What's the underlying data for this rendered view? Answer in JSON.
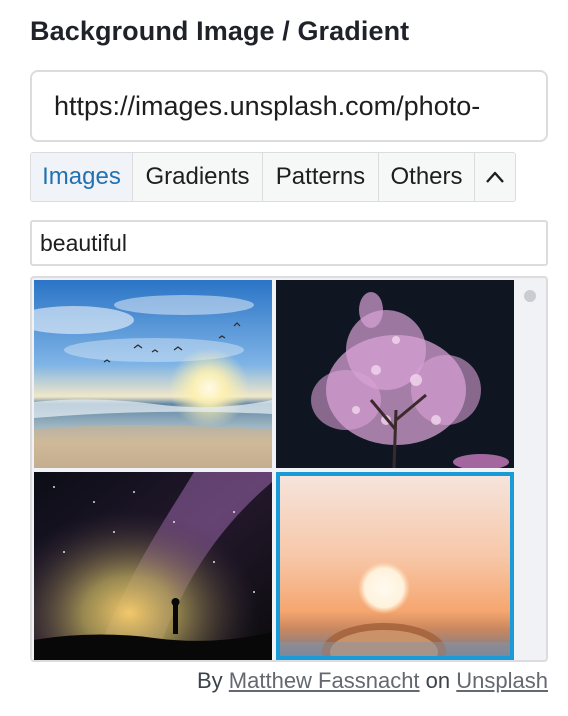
{
  "title": "Background Image / Gradient",
  "url_input": {
    "value": "https://images.unsplash.com/photo-"
  },
  "tabs": [
    {
      "label": "Images",
      "active": true
    },
    {
      "label": "Gradients",
      "active": false
    },
    {
      "label": "Patterns",
      "active": false
    },
    {
      "label": "Others",
      "active": false
    }
  ],
  "tab_toggle_icon": "chevron-up-icon",
  "search": {
    "value": "beautiful"
  },
  "images": [
    {
      "subject": "beach-sunset-birds",
      "selected": false
    },
    {
      "subject": "pink-blossom-tree-night",
      "selected": false
    },
    {
      "subject": "milky-way-silhouette",
      "selected": false
    },
    {
      "subject": "sunrise-orb-horizon",
      "selected": true
    }
  ],
  "credit": {
    "prefix": "By",
    "author": "Matthew Fassnacht",
    "middle": "on",
    "site": "Unsplash"
  },
  "colors": {
    "accent": "#2271b1",
    "selected_border": "#1a9ad6"
  }
}
